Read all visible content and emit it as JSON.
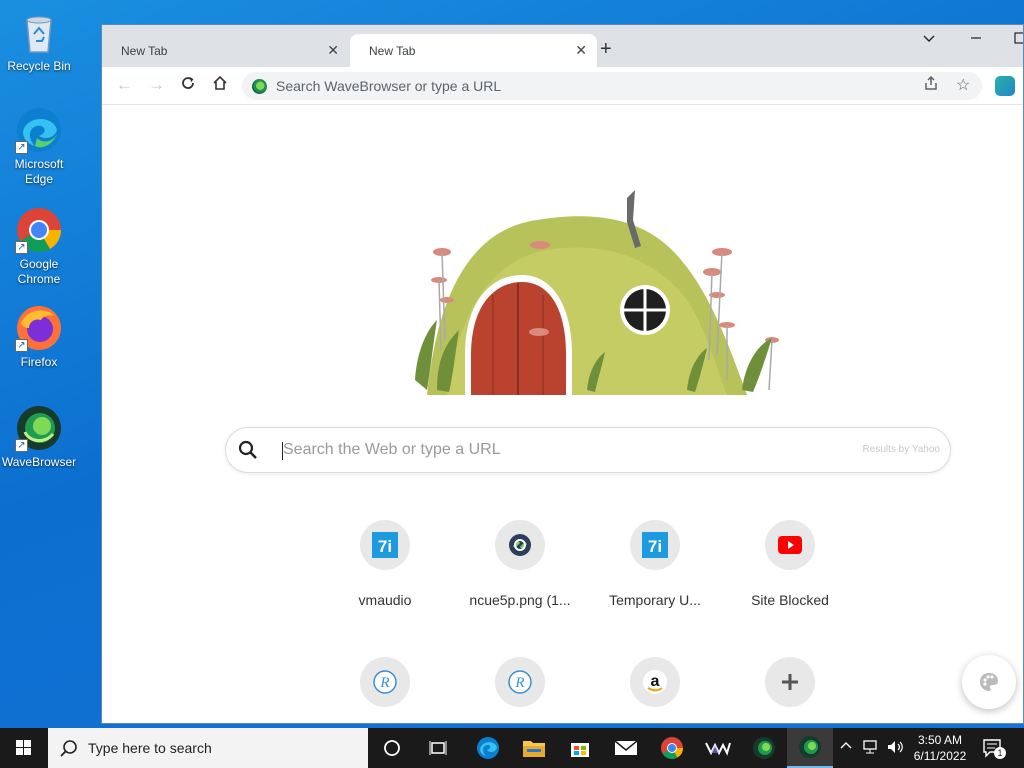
{
  "desktop": {
    "icons": [
      {
        "label": "Recycle Bin",
        "icon": "recycle-bin-icon"
      },
      {
        "label": "Microsoft Edge",
        "icon": "edge-icon"
      },
      {
        "label": "Google Chrome",
        "icon": "chrome-icon"
      },
      {
        "label": "Firefox",
        "icon": "firefox-icon"
      },
      {
        "label": "WaveBrowser",
        "icon": "wavebrowser-icon"
      }
    ]
  },
  "browser": {
    "tabs": [
      {
        "title": "New Tab",
        "active": false
      },
      {
        "title": "New Tab",
        "active": true
      }
    ],
    "address_placeholder": "Search WaveBrowser or type a URL"
  },
  "newtab": {
    "search_placeholder": "Search the Web or type a URL",
    "search_provider": "Results by Yahoo",
    "shortcuts": [
      {
        "label": "vmaudio",
        "icon": "7i-icon"
      },
      {
        "label": "ncue5p.png (1...",
        "icon": "link-icon"
      },
      {
        "label": "Temporary U...",
        "icon": "7i-icon"
      },
      {
        "label": "Site Blocked",
        "icon": "youtube-icon"
      },
      {
        "label": "",
        "icon": "r-icon"
      },
      {
        "label": "",
        "icon": "r-icon"
      },
      {
        "label": "",
        "icon": "amazon-icon"
      },
      {
        "label": "",
        "icon": "add-icon"
      }
    ]
  },
  "taskbar": {
    "search_placeholder": "Type here to search",
    "time": "3:50 AM",
    "date": "6/11/2022",
    "notification_count": "1"
  },
  "colors": {
    "desktop_bg": "#0c6fd0",
    "taskbar_bg": "#1a1a1a",
    "tab_strip_bg": "#dee1e6",
    "brand_7i": "#1e9be0",
    "youtube_red": "#ff0000"
  }
}
